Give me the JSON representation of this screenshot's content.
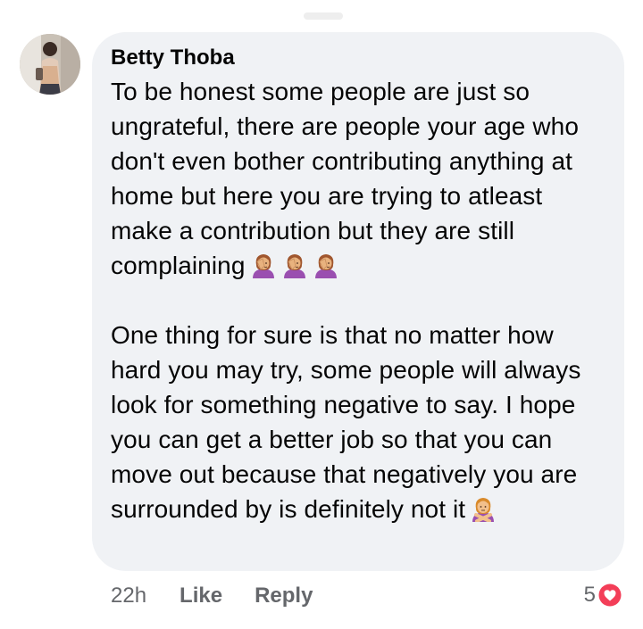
{
  "comment": {
    "author": "Betty Thoba",
    "paragraphs": [
      "To be honest some people are just so ungrateful, there are people your age who don't even bother contributing anything at home but here you are trying to atleast make a contribution but they are still complaining",
      "One thing for sure is that no matter how hard you may try, some people will always look for something negative to say. I hope you can get a better job so that you can move out because  that negatively you are surrounded by is definitely not it"
    ],
    "paragraph1_emojis": [
      "woman-facepalming-emoji",
      "woman-facepalming-emoji",
      "woman-facepalming-emoji"
    ],
    "paragraph2_emojis": [
      "woman-gesturing-no-emoji"
    ]
  },
  "footer": {
    "time": "22h",
    "like_label": "Like",
    "reply_label": "Reply",
    "reaction_count": "5",
    "reaction_icon": "heart-reaction-icon"
  },
  "colors": {
    "bubble_bg": "#f0f2f5",
    "text": "#050505",
    "meta_text": "#65676b",
    "heart": "#f33e58"
  }
}
